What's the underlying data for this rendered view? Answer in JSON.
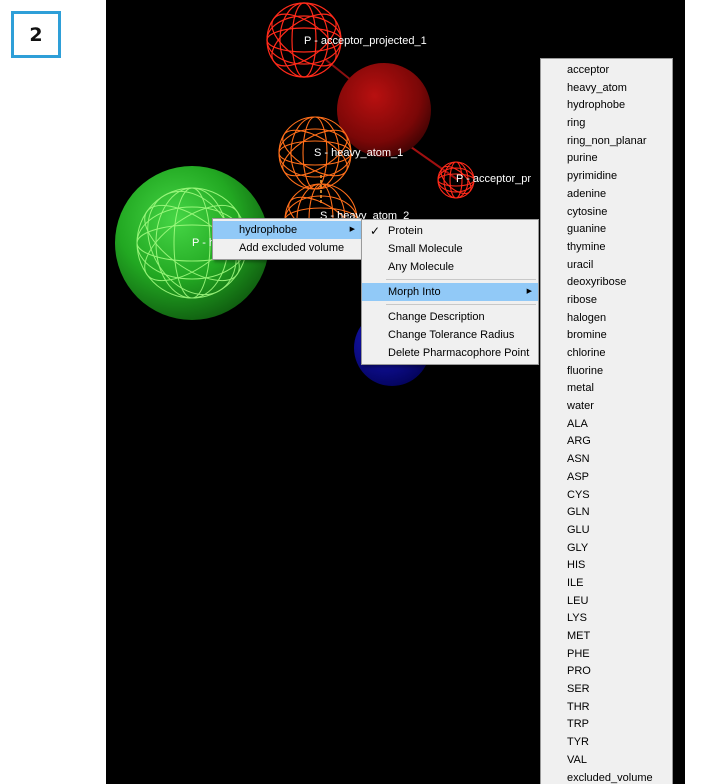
{
  "step_badge": "2",
  "viewer": {
    "labels": {
      "acceptor_projected_1": "P - acceptor_projected_1",
      "heavy_atom_1": "S - heavy_atom_1",
      "acceptor_projected_2": "P - acceptor_pr",
      "heavy_atom_2": "S - heavy_atom_2",
      "hydrophobe_point": "P - h"
    },
    "colors": {
      "background": "#000000",
      "acceptor_mesh": "#ff2a1a",
      "acceptor_solid": "#8b0a0a",
      "heavy_atom_mesh": "#ff6f1a",
      "hydrophobe_solid": "#2eb52e",
      "hydrophobe_mesh": "#9aff7a",
      "blue_sphere": "#0a0a9a"
    }
  },
  "context_menu": {
    "items": [
      {
        "label": "hydrophobe",
        "has_submenu": true,
        "highlighted": true
      },
      {
        "label": "Add excluded volume",
        "has_submenu": false,
        "highlighted": false
      }
    ]
  },
  "submenu": {
    "group1": [
      {
        "label": "Protein",
        "checked": true
      },
      {
        "label": "Small Molecule",
        "checked": false
      },
      {
        "label": "Any Molecule",
        "checked": false
      }
    ],
    "morph_into": {
      "label": "Morph Into",
      "has_submenu": true
    },
    "group2": [
      {
        "label": "Change Description"
      },
      {
        "label": "Change Tolerance Radius"
      },
      {
        "label": "Delete Pharmacophore Point"
      }
    ]
  },
  "morph_list": [
    "acceptor",
    "heavy_atom",
    "hydrophobe",
    "ring",
    "ring_non_planar",
    "purine",
    "pyrimidine",
    "adenine",
    "cytosine",
    "guanine",
    "thymine",
    "uracil",
    "deoxyribose",
    "ribose",
    "halogen",
    "bromine",
    "chlorine",
    "fluorine",
    "metal",
    "water",
    "ALA",
    "ARG",
    "ASN",
    "ASP",
    "CYS",
    "GLN",
    "GLU",
    "GLY",
    "HIS",
    "ILE",
    "LEU",
    "LYS",
    "MET",
    "PHE",
    "PRO",
    "SER",
    "THR",
    "TRP",
    "TYR",
    "VAL",
    "excluded_volume"
  ]
}
